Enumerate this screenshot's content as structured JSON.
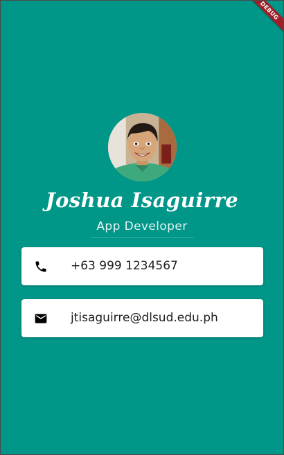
{
  "theme": {
    "background": "#009688",
    "card": "#ffffff",
    "text": "#1d1d1d",
    "banner": "#a11f28"
  },
  "debug_banner": {
    "label": "DEBUG"
  },
  "profile": {
    "name": "Joshua Isaguirre",
    "title": "App Developer"
  },
  "contacts": [
    {
      "icon": "phone-icon",
      "value": "+63 999 1234567"
    },
    {
      "icon": "email-icon",
      "value": "jtisaguirre@dlsud.edu.ph"
    }
  ]
}
